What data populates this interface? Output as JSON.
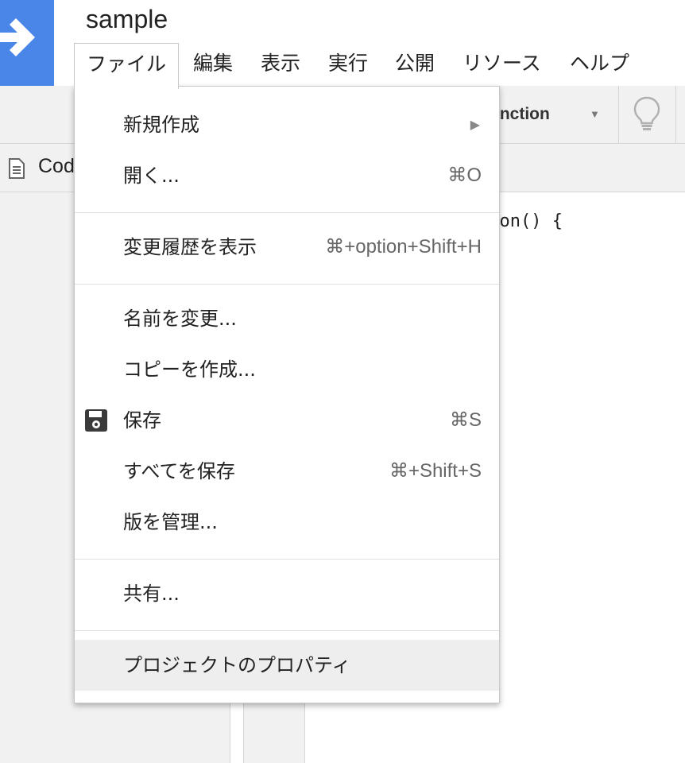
{
  "header": {
    "title": "sample",
    "logo_icon": "arrow-right-icon",
    "accent": "#4a86e8"
  },
  "menubar": {
    "items": [
      {
        "label": "ファイル",
        "open": true
      },
      {
        "label": "編集"
      },
      {
        "label": "表示"
      },
      {
        "label": "実行"
      },
      {
        "label": "公開"
      },
      {
        "label": "リソース"
      },
      {
        "label": "ヘルプ"
      }
    ]
  },
  "toolbar": {
    "function_select": "unction",
    "bulb_icon": "lightbulb-icon"
  },
  "file_tab": {
    "name": "Cod",
    "icon": "document-icon"
  },
  "editor": {
    "visible_code": "tion() {"
  },
  "file_menu": {
    "items": [
      {
        "label": "新規作成",
        "submenu": "▶"
      },
      {
        "label": "開く...",
        "shortcut": "⌘O"
      },
      {
        "label": "変更履歴を表示",
        "shortcut": "⌘+option+Shift+H"
      },
      {
        "label": "名前を変更..."
      },
      {
        "label": "コピーを作成..."
      },
      {
        "label": "保存",
        "shortcut": "⌘S",
        "icon": "floppy-disk-icon"
      },
      {
        "label": "すべてを保存",
        "shortcut": "⌘+Shift+S"
      },
      {
        "label": "版を管理..."
      },
      {
        "label": "共有..."
      },
      {
        "label": "プロジェクトのプロパティ",
        "highlighted": true
      }
    ]
  }
}
